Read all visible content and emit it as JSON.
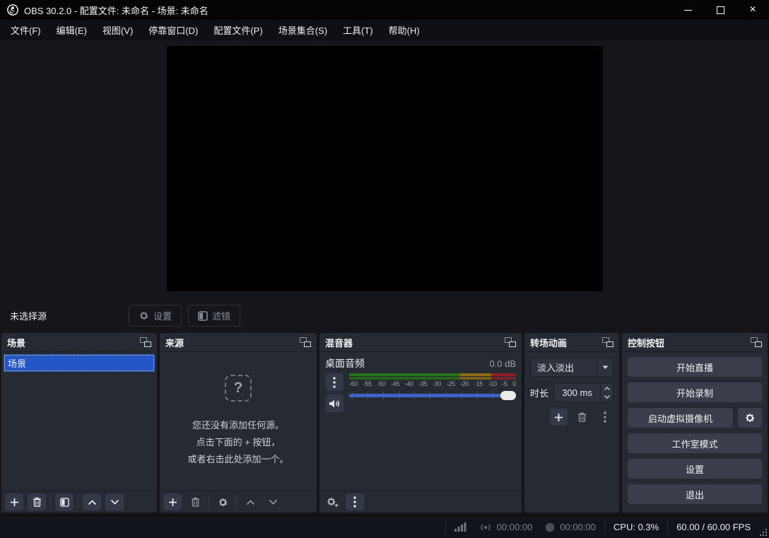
{
  "window": {
    "title": "OBS 30.2.0 - 配置文件: 未命名 - 场景: 未命名"
  },
  "menu": {
    "items": [
      "文件(F)",
      "编辑(E)",
      "视图(V)",
      "停靠窗口(D)",
      "配置文件(P)",
      "场景集合(S)",
      "工具(T)",
      "帮助(H)"
    ]
  },
  "selected_source_bar": {
    "label": "未选择源",
    "properties": "设置",
    "filters": "滤镜"
  },
  "scenes": {
    "title": "场景",
    "items": [
      "场景"
    ]
  },
  "sources": {
    "title": "来源",
    "empty_glyph": "?",
    "empty_line1": "您还没有添加任何源。",
    "empty_line2": "点击下面的 + 按钮，",
    "empty_line3": "或者右击此处添加一个。"
  },
  "mixer": {
    "title": "混音器",
    "channel_name": "桌面音频",
    "level_db": "0.0 dB",
    "scale": [
      "-60",
      "-55",
      "-50",
      "-45",
      "-40",
      "-35",
      "-30",
      "-25",
      "-20",
      "-15",
      "-10",
      "-5",
      "0"
    ]
  },
  "transitions": {
    "title": "转场动画",
    "current": "淡入淡出",
    "duration_label": "时长",
    "duration_value": "300 ms"
  },
  "controls": {
    "title": "控制按钮",
    "buttons": [
      "开始直播",
      "开始录制",
      "启动虚拟摄像机",
      "工作室模式",
      "设置",
      "退出"
    ]
  },
  "status": {
    "stream_time": "00:00:00",
    "record_time": "00:00:00",
    "cpu": "CPU: 0.3%",
    "fps": "60.00 / 60.00 FPS"
  },
  "colors": {
    "selection_blue": "#2457c5",
    "slider_blue": "#3e63c8",
    "meter_green": "#267119",
    "meter_yellow": "#8a6a12",
    "meter_red": "#8c1e28",
    "focus_outline": "#cfc87d"
  }
}
